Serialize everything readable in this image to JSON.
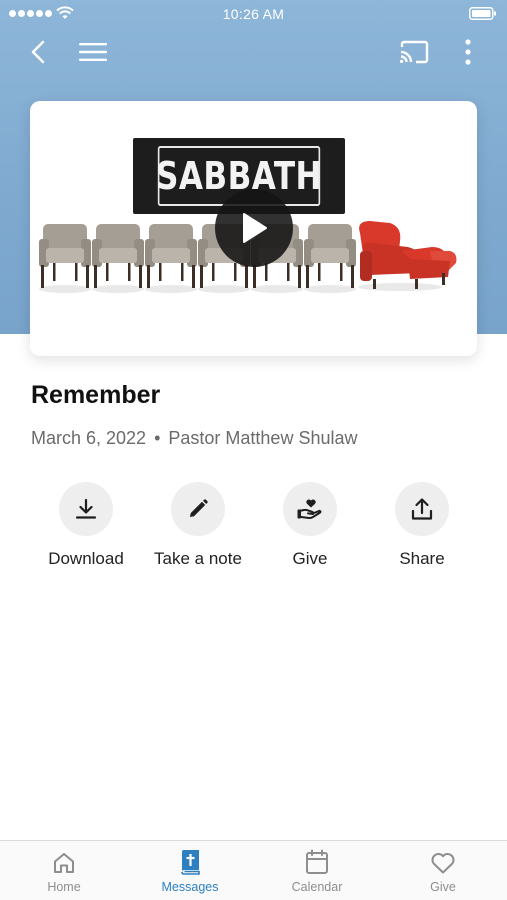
{
  "status_bar": {
    "time": "10:26 AM"
  },
  "video": {
    "sign_text": "SABBATH"
  },
  "sermon": {
    "title": "Remember",
    "date": "March 6, 2022",
    "separator": "•",
    "speaker": "Pastor Matthew Shulaw"
  },
  "actions": [
    {
      "label": "Download",
      "icon": "download-icon"
    },
    {
      "label": "Take a note",
      "icon": "pencil-icon"
    },
    {
      "label": "Give",
      "icon": "hand-heart-icon"
    },
    {
      "label": "Share",
      "icon": "share-icon"
    }
  ],
  "tabs": [
    {
      "label": "Home",
      "icon": "home-icon",
      "active": false
    },
    {
      "label": "Messages",
      "icon": "bible-icon",
      "active": true
    },
    {
      "label": "Calendar",
      "icon": "calendar-icon",
      "active": false
    },
    {
      "label": "Give",
      "icon": "heart-icon",
      "active": false
    }
  ],
  "colors": {
    "header_blue": "#7fa9cf",
    "active_tab": "#2e7fbf",
    "inactive_tab": "#8e8e8e",
    "recliner_red": "#d8392b"
  }
}
